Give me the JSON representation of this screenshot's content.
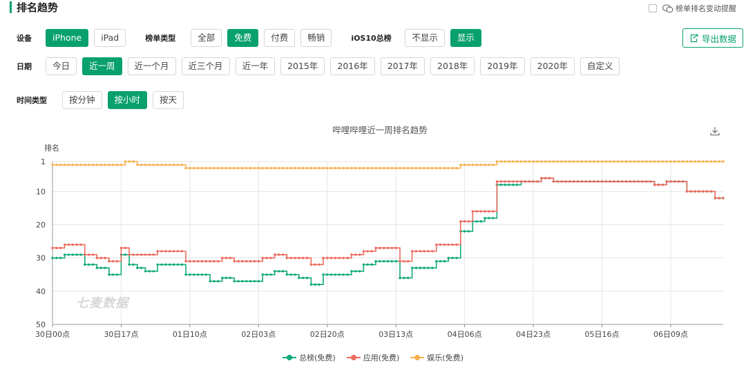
{
  "header": {
    "title": "排名趋势",
    "remind_label": "榜单排名变动提醒"
  },
  "filters": {
    "device": {
      "label": "设备",
      "options": [
        "iPhone",
        "iPad"
      ],
      "selected": "iPhone"
    },
    "list_type": {
      "label": "榜单类型",
      "options": [
        "全部",
        "免费",
        "付费",
        "畅销"
      ],
      "selected": "免费"
    },
    "ios10": {
      "label": "iOS10总榜",
      "options": [
        "不显示",
        "显示"
      ],
      "selected": "显示"
    },
    "date": {
      "label": "日期",
      "options": [
        "今日",
        "近一周",
        "近一个月",
        "近三个月",
        "近一年",
        "2015年",
        "2016年",
        "2017年",
        "2018年",
        "2019年",
        "2020年",
        "自定义"
      ],
      "selected": "近一周"
    },
    "time_type": {
      "label": "时间类型",
      "options": [
        "按分钟",
        "按小时",
        "按天"
      ],
      "selected": "按小时"
    }
  },
  "export_label": "导出数据",
  "watermark": "七麦数据",
  "colors": {
    "accent": "#08a06e",
    "series_total": "#12a97c",
    "series_app": "#ec6b5e",
    "series_ent": "#f6b04f",
    "grid": "#e4e4e4"
  },
  "chart_data": {
    "type": "line",
    "title": "哔哩哔哩近一周排名趋势",
    "ylabel": "排名",
    "y_inverted": true,
    "ylim": [
      1,
      50
    ],
    "yticks": [
      1,
      10,
      20,
      30,
      40,
      50
    ],
    "x_range": [
      0,
      166
    ],
    "xticks": [
      {
        "label": "30日00点",
        "pos": 0
      },
      {
        "label": "30日17点",
        "pos": 17
      },
      {
        "label": "01日10点",
        "pos": 34
      },
      {
        "label": "02日03点",
        "pos": 51
      },
      {
        "label": "02日20点",
        "pos": 68
      },
      {
        "label": "03日13点",
        "pos": 85
      },
      {
        "label": "04日06点",
        "pos": 102
      },
      {
        "label": "04日23点",
        "pos": 119
      },
      {
        "label": "05日16点",
        "pos": 136
      },
      {
        "label": "06日09点",
        "pos": 153
      }
    ],
    "legend_position": "bottom",
    "series": [
      {
        "name": "总榜(免费)",
        "color": "#12a97c",
        "segments": [
          [
            0,
            30
          ],
          [
            3,
            30
          ],
          [
            3,
            29
          ],
          [
            8,
            29
          ],
          [
            8,
            32
          ],
          [
            11,
            32
          ],
          [
            11,
            33
          ],
          [
            14,
            33
          ],
          [
            14,
            35
          ],
          [
            17,
            35
          ],
          [
            17,
            29
          ],
          [
            19,
            29
          ],
          [
            19,
            32
          ],
          [
            21,
            32
          ],
          [
            21,
            33
          ],
          [
            23,
            33
          ],
          [
            23,
            34
          ],
          [
            26,
            34
          ],
          [
            26,
            32
          ],
          [
            33,
            32
          ],
          [
            33,
            35
          ],
          [
            39,
            35
          ],
          [
            39,
            37
          ],
          [
            42,
            37
          ],
          [
            42,
            36
          ],
          [
            45,
            36
          ],
          [
            45,
            37
          ],
          [
            52,
            37
          ],
          [
            52,
            35
          ],
          [
            55,
            35
          ],
          [
            55,
            34
          ],
          [
            58,
            34
          ],
          [
            58,
            35
          ],
          [
            61,
            35
          ],
          [
            61,
            36
          ],
          [
            64,
            36
          ],
          [
            64,
            38
          ],
          [
            67,
            38
          ],
          [
            67,
            35
          ],
          [
            74,
            35
          ],
          [
            74,
            34
          ],
          [
            77,
            34
          ],
          [
            77,
            32
          ],
          [
            80,
            32
          ],
          [
            80,
            31
          ],
          [
            86,
            31
          ],
          [
            86,
            36
          ],
          [
            89,
            36
          ],
          [
            89,
            33
          ],
          [
            95,
            33
          ],
          [
            95,
            31
          ],
          [
            98,
            31
          ],
          [
            98,
            30
          ],
          [
            101,
            30
          ],
          [
            101,
            22
          ],
          [
            104,
            22
          ],
          [
            104,
            19
          ],
          [
            107,
            19
          ],
          [
            107,
            18
          ],
          [
            110,
            18
          ],
          [
            110,
            8
          ],
          [
            116,
            8
          ],
          [
            116,
            7
          ],
          [
            121,
            7
          ],
          [
            121,
            6
          ],
          [
            124,
            6
          ],
          [
            124,
            7
          ],
          [
            149,
            7
          ],
          [
            149,
            8
          ],
          [
            152,
            8
          ],
          [
            152,
            7
          ],
          [
            157,
            7
          ],
          [
            157,
            10
          ],
          [
            164,
            10
          ],
          [
            164,
            12
          ],
          [
            166,
            12
          ]
        ]
      },
      {
        "name": "应用(免费)",
        "color": "#ec6b5e",
        "segments": [
          [
            0,
            27
          ],
          [
            3,
            27
          ],
          [
            3,
            26
          ],
          [
            8,
            26
          ],
          [
            8,
            29
          ],
          [
            11,
            29
          ],
          [
            11,
            30
          ],
          [
            14,
            30
          ],
          [
            14,
            31
          ],
          [
            17,
            31
          ],
          [
            17,
            27
          ],
          [
            19,
            27
          ],
          [
            19,
            29
          ],
          [
            26,
            29
          ],
          [
            26,
            28
          ],
          [
            33,
            28
          ],
          [
            33,
            31
          ],
          [
            42,
            31
          ],
          [
            42,
            30
          ],
          [
            45,
            30
          ],
          [
            45,
            31
          ],
          [
            52,
            31
          ],
          [
            52,
            30
          ],
          [
            55,
            30
          ],
          [
            55,
            29
          ],
          [
            58,
            29
          ],
          [
            58,
            30
          ],
          [
            64,
            30
          ],
          [
            64,
            32
          ],
          [
            67,
            32
          ],
          [
            67,
            30
          ],
          [
            74,
            30
          ],
          [
            74,
            29
          ],
          [
            77,
            29
          ],
          [
            77,
            28
          ],
          [
            80,
            28
          ],
          [
            80,
            27
          ],
          [
            86,
            27
          ],
          [
            86,
            31
          ],
          [
            89,
            31
          ],
          [
            89,
            28
          ],
          [
            95,
            28
          ],
          [
            95,
            26
          ],
          [
            101,
            26
          ],
          [
            101,
            19
          ],
          [
            104,
            19
          ],
          [
            104,
            16
          ],
          [
            110,
            16
          ],
          [
            110,
            7
          ],
          [
            121,
            7
          ],
          [
            121,
            6
          ],
          [
            124,
            6
          ],
          [
            124,
            7
          ],
          [
            149,
            7
          ],
          [
            149,
            8
          ],
          [
            152,
            8
          ],
          [
            152,
            7
          ],
          [
            157,
            7
          ],
          [
            157,
            10
          ],
          [
            164,
            10
          ],
          [
            164,
            12
          ],
          [
            166,
            12
          ]
        ]
      },
      {
        "name": "娱乐(免费)",
        "color": "#f6b04f",
        "segments": [
          [
            0,
            2
          ],
          [
            18,
            2
          ],
          [
            18,
            1
          ],
          [
            21,
            1
          ],
          [
            21,
            2
          ],
          [
            33,
            2
          ],
          [
            33,
            3
          ],
          [
            101,
            3
          ],
          [
            101,
            2
          ],
          [
            110,
            2
          ],
          [
            110,
            1
          ],
          [
            166,
            1
          ]
        ]
      }
    ]
  }
}
